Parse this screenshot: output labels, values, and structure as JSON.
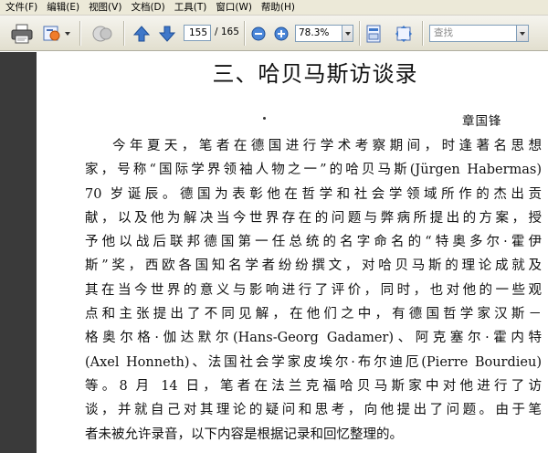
{
  "menu": [
    "文件(F)",
    "编辑(E)",
    "视图(V)",
    "文档(D)",
    "工具(T)",
    "窗口(W)",
    "帮助(H)"
  ],
  "toolbar": {
    "current_page": "155",
    "page_total": "/ 165",
    "zoom": "78.3%",
    "find_placeholder": "查找"
  },
  "document": {
    "title": "三、哈贝马斯访谈录",
    "author": "章国锋",
    "lines": [
      "今年夏天，笔者在德国进行学术考察期间，时逢著名思想",
      "家，号称“国际学界领袖人物之一”的哈贝马斯(Jürgen Habermas)",
      "70 岁诞辰。德国为表彰他在哲学和社会学领域所作的杰出贡",
      "献，以及他为解决当今世界存在的问题与弊病所提出的方案，授",
      "予他以战后联邦德国第一任总统的名字命名的“特奥多尔·霍伊",
      "斯”奖，西欧各国知名学者纷纷撰文，对哈贝马斯的理论成就及",
      "其在当今世界的意义与影响进行了评价，同时，也对他的一些观",
      "点和主张提出了不同见解，在他们之中，有德国哲学家汉斯－",
      "格奥尔格·伽达默尔(Hans-Georg Gadamer)、阿克塞尔·霍内特",
      "(Axel Honneth)、法国社会学家皮埃尔·布尔迪厄(Pierre Bourdieu)",
      "等。8 月 14 日，笔者在法兰克福哈贝马斯家中对他进行了访",
      "谈，并就自己对其理论的疑问和思考，向他提出了问题。由于笔",
      "者未被允许录音，以下内容是根据记录和回忆整理的。"
    ]
  }
}
